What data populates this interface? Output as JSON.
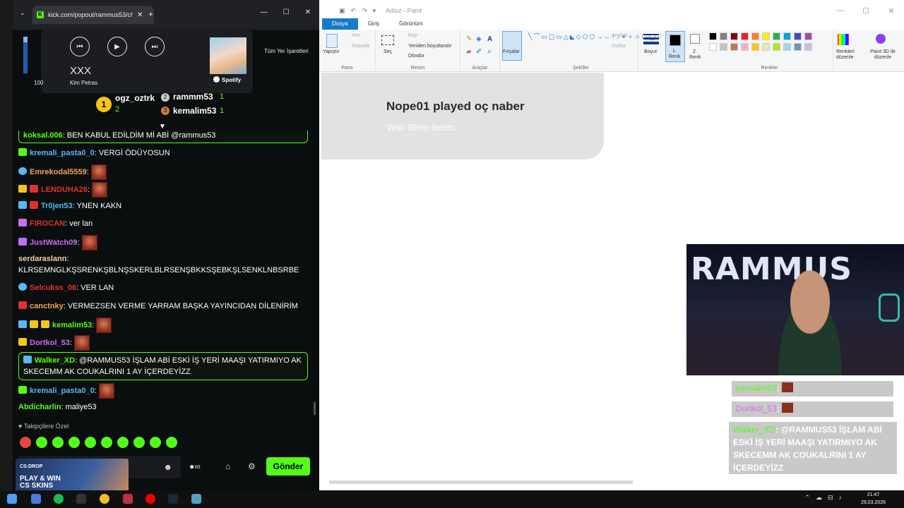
{
  "paint": {
    "title": "Adsız - Paint",
    "tabs": [
      "Dosya",
      "Giriş",
      "Görünüm"
    ],
    "ribbon": {
      "pano": {
        "label": "Pano",
        "paste": "Yapıştır",
        "cut": "Kes",
        "copy": "Kopyala"
      },
      "resim": {
        "label": "Resim",
        "select": "Seç",
        "crop": "Kırp",
        "resize": "Yeniden boyutlandır",
        "rotate": "Döndür"
      },
      "araclar": {
        "label": "Araçlar"
      },
      "fircalar": {
        "label": "Fırçalar"
      },
      "sekiller": {
        "label": "Şekiller",
        "outline": "Anahat",
        "fill": "Doldur"
      },
      "boyut": {
        "label": "Boyut"
      },
      "renk1": {
        "label1": "1.",
        "label2": "Renk"
      },
      "renk2": {
        "label1": "2.",
        "label2": "Renk"
      },
      "renkler": {
        "label": "Renkler",
        "edit": "Renkleri düzenle",
        "paint3d": "Paint 3D ile düzenle"
      },
      "palette_row1": [
        "#000000",
        "#7f7f7f",
        "#880015",
        "#ed1c24",
        "#ff7f27",
        "#fff200",
        "#22b14c",
        "#00a2e8",
        "#3f48cc",
        "#a349a4"
      ],
      "palette_row2": [
        "#ffffff",
        "#c3c3c3",
        "#b97a57",
        "#ffaec9",
        "#ffc90e",
        "#efe4b0",
        "#b5e61d",
        "#99d9ea",
        "#7092be",
        "#c8bfe7"
      ]
    }
  },
  "now_playing": {
    "title": "Nope01 played oç naber",
    "subtitle": "With Blerp Beets"
  },
  "browser": {
    "tab_title": "kick.com/popout/rammus53/ch",
    "bookmarks_label": "Tüm Yer İşaretleri",
    "favicon": "K"
  },
  "media": {
    "volume_value": "100",
    "title": "XXX",
    "artist": "Kim Petras",
    "source": "Spotify"
  },
  "leaderboard": {
    "first": {
      "name": "ogz_oztrk",
      "rank": "1",
      "count": "2"
    },
    "second": {
      "name": "rammm53",
      "count": "1"
    },
    "third": {
      "name": "kemalim53",
      "count": "1"
    }
  },
  "chat": {
    "messages": [
      {
        "user": "koksal.006",
        "text": ": BEN KABUL EDİLDİM Mİ ABİ @rammus53",
        "color": "#53fc18",
        "highlight": true
      },
      {
        "user": "kremali_pasta0_0",
        "text": ": VERGİ ÖDÜYOSUN",
        "color": "#58b7f6"
      },
      {
        "user": "Emrekodal5559",
        "text": ":",
        "color": "#f5a34a",
        "emote": true
      },
      {
        "user": "LENDUHA26",
        "text": ":",
        "color": "#e0322c",
        "emote": true
      },
      {
        "user": "Tr0jen53",
        "text": ": YNEN KAKN",
        "color": "#58b7f6"
      },
      {
        "user": "FIROCAN",
        "text": ": ver lan",
        "color": "#e0322c"
      },
      {
        "user": "JustWatch09",
        "text": ":",
        "color": "#c86cf0",
        "emote": true
      },
      {
        "user": "serdaraslann",
        "text": ":",
        "color": "#f5d19a"
      },
      {
        "user": "",
        "text": "KLRSEMNGLKŞSRENKŞBLNŞSKERLBLRSENŞBKKSŞEBKŞLSENKLNBSRBE",
        "color": "#fff"
      },
      {
        "user": "Selcukss_06",
        "text": ": VER LAN",
        "color": "#e0322c"
      },
      {
        "user": "canctnky",
        "text": ": VERMEZSEN VERME YARRAM BAŞKA YAYINCIDAN DİLENİRİM",
        "color": "#f5a34a"
      },
      {
        "user": "kemalim53",
        "text": ":",
        "color": "#53fc18",
        "emote": true
      },
      {
        "user": "Dortkol_53",
        "text": ":",
        "color": "#c86cf0",
        "emote": true
      },
      {
        "user": "Walker_XD",
        "text": ": @RAMMUS53 İŞLAM ABİ ESKİ İŞ YERİ MAAŞI YATIRMIYO AK SKECEMM AK COUKALRINI 1 AY İÇERDEYİZZ",
        "color": "#53fc18",
        "highlight": true
      },
      {
        "user": "kremali_pasta0_0",
        "text": ":",
        "color": "#58b7f6",
        "emote": true
      },
      {
        "user": "Abdicharlin",
        "text": ": maliye53",
        "color": "#53fc18"
      }
    ],
    "followers_label": "Takipçilere Özel",
    "send_label": "Gönder"
  },
  "promo": {
    "brand": "CS:DROP",
    "text": "PLAY & WIN CS SKINS"
  },
  "webcam": {
    "sign": "RAMMUS"
  },
  "overlay_chat": [
    {
      "user": "kemalim53",
      "text": ":"
    },
    {
      "user": "Dortkol_53",
      "text": ":"
    },
    {
      "user": "Walker_XD",
      "text": ": @RAMMUS53 İŞLAM ABİ ESKİ İŞ YERİ MAAŞI YATIRMIYO AK SKECEMM AK COUKALRINI 1 AY İÇERDEYİZZ"
    }
  ],
  "taskbar": {
    "time": "21:47",
    "date": "29.03.2026"
  }
}
